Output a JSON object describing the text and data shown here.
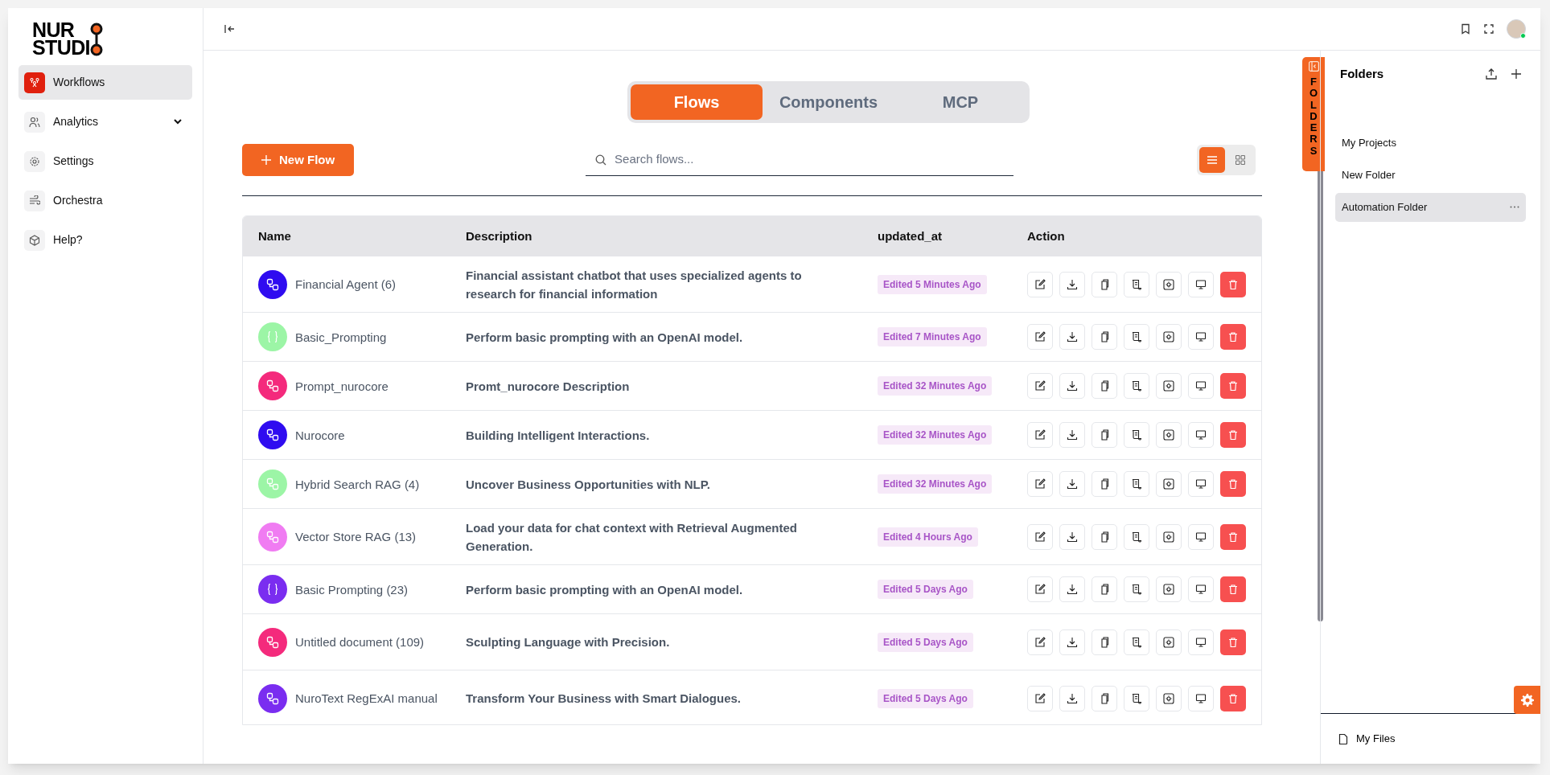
{
  "logo": {
    "line_1": "NUR",
    "line_2": "STUDI"
  },
  "sidebar": {
    "items": [
      {
        "label": "Workflows",
        "selected": true,
        "expandable": false
      },
      {
        "label": "Analytics",
        "selected": false,
        "expandable": true
      },
      {
        "label": "Settings",
        "selected": false,
        "expandable": false
      },
      {
        "label": "Orchestra",
        "selected": false,
        "expandable": false
      },
      {
        "label": "Help?",
        "selected": false,
        "expandable": false
      }
    ]
  },
  "tabs": [
    {
      "label": "Flows",
      "selected": true
    },
    {
      "label": "Components",
      "selected": false
    },
    {
      "label": "MCP",
      "selected": false
    }
  ],
  "new_flow_button": "New Flow",
  "search": {
    "placeholder": "Search flows..."
  },
  "view_toggle": [
    {
      "kind": "list",
      "selected": true
    },
    {
      "kind": "grid",
      "selected": false
    }
  ],
  "table": {
    "columns": [
      "Name",
      "Description",
      "updated_at",
      "Action"
    ],
    "rows": [
      {
        "kind": "flow",
        "color": "#2f0cf0",
        "name": "Financial Agent (6)",
        "description": "Financial assistant chatbot that uses specialized agents to research for financial information",
        "updated_at": "Edited 5 Minutes Ago"
      },
      {
        "kind": "prompt",
        "color": "#9cf5a6",
        "name": "Basic_Prompting",
        "description": "Perform basic prompting with an OpenAI model.",
        "updated_at": "Edited 7 Minutes Ago"
      },
      {
        "kind": "flow",
        "color": "#f42a7c",
        "name": "Prompt_nurocore",
        "description": "Promt_nurocore Description",
        "updated_at": "Edited 32 Minutes Ago"
      },
      {
        "kind": "flow",
        "color": "#2f0cf0",
        "name": "Nurocore",
        "description": "Building Intelligent Interactions.",
        "updated_at": "Edited 32 Minutes Ago"
      },
      {
        "kind": "flow",
        "color": "#9cf5a6",
        "name": "Hybrid Search RAG (4)",
        "description": "Uncover Business Opportunities with NLP.",
        "updated_at": "Edited 32 Minutes Ago"
      },
      {
        "kind": "flow",
        "color": "#f07cf2",
        "name": "Vector Store RAG (13)",
        "description": "Load your data for chat context with Retrieval Augmented Generation.",
        "updated_at": "Edited 4 Hours Ago"
      },
      {
        "kind": "prompt",
        "color": "#7a2df0",
        "name": "Basic Prompting (23)",
        "description": "Perform basic prompting with an OpenAI model.",
        "updated_at": "Edited 5 Days Ago"
      },
      {
        "kind": "flow",
        "color": "#f42a7c",
        "name": "Untitled document (109)",
        "description": "Sculpting Language with Precision.",
        "updated_at": "Edited 5 Days Ago"
      },
      {
        "kind": "flow",
        "color": "#7a2df0",
        "name": "NuroText RegExAI manual",
        "description": "Transform Your Business with Smart Dialogues.",
        "updated_at": "Edited 5 Days Ago"
      }
    ]
  },
  "folders_tab": "FOLDERS",
  "folders": {
    "title": "Folders",
    "items": [
      {
        "label": "My Projects",
        "selected": false
      },
      {
        "label": "New Folder",
        "selected": false
      },
      {
        "label": "Automation Folder",
        "selected": true
      }
    ],
    "footer": "My Files"
  }
}
